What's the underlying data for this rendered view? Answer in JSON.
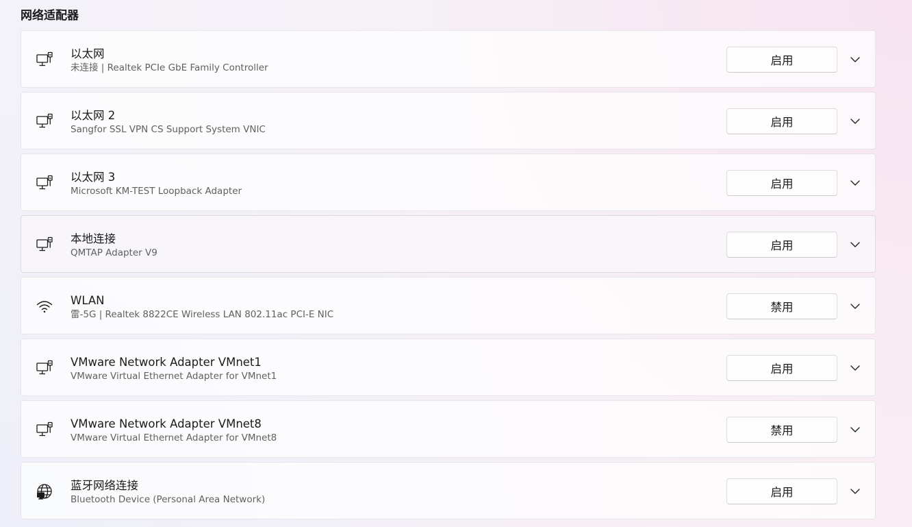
{
  "section": {
    "title": "网络适配器"
  },
  "adapters": [
    {
      "name": "以太网",
      "description": "未连接 | Realtek PCIe GbE Family Controller",
      "action_label": "启用",
      "icon": "ethernet-icon"
    },
    {
      "name": "以太网 2",
      "description": "Sangfor SSL VPN CS Support System VNIC",
      "action_label": "启用",
      "icon": "ethernet-icon"
    },
    {
      "name": "以太网 3",
      "description": "Microsoft KM-TEST Loopback Adapter",
      "action_label": "启用",
      "icon": "ethernet-icon"
    },
    {
      "name": "本地连接",
      "description": "QMTAP Adapter V9",
      "action_label": "启用",
      "icon": "ethernet-icon"
    },
    {
      "name": "WLAN",
      "description": "雷-5G | Realtek 8822CE Wireless LAN 802.11ac PCI-E NIC",
      "action_label": "禁用",
      "icon": "wifi-icon"
    },
    {
      "name": "VMware Network Adapter VMnet1",
      "description": "VMware Virtual Ethernet Adapter for VMnet1",
      "action_label": "启用",
      "icon": "ethernet-icon"
    },
    {
      "name": "VMware Network Adapter VMnet8",
      "description": "VMware Virtual Ethernet Adapter for VMnet8",
      "action_label": "禁用",
      "icon": "ethernet-icon"
    },
    {
      "name": "蓝牙网络连接",
      "description": "Bluetooth Device (Personal Area Network)",
      "action_label": "启用",
      "icon": "bluetooth-network-icon"
    }
  ],
  "icons": {
    "expand": "chevron-down-icon"
  },
  "colors": {
    "card_background": "#ffffff",
    "card_border": "#e6e3ea",
    "primary_text": "#1b1b1b",
    "secondary_text": "#606060"
  }
}
